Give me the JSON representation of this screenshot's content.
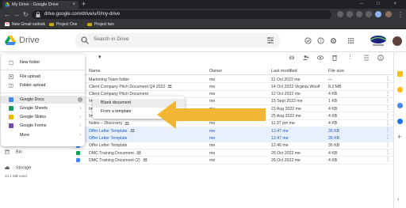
{
  "browser": {
    "tab_title": "My Drive - Google Drive",
    "tab_close": "×",
    "new_tab": "+",
    "window_controls": "–  □  ×",
    "url": "drive.google.com/drive/u/0/my-drive",
    "bookmarks": [
      "New Gmail outlook",
      "Project One",
      "Project two"
    ]
  },
  "drive": {
    "title": "Drive",
    "search_placeholder": "Search in Drive"
  },
  "toolbar": {
    "breadcrumb_chevron": "▾"
  },
  "table": {
    "headers": {
      "name": "Name",
      "owner": "Owner",
      "modified": "Last modified",
      "size": "File size"
    },
    "rows": [
      {
        "name": "Marketing Team folder",
        "owner": "me",
        "modified": "11 Oct 2022 me",
        "size": "—",
        "icon": "folder",
        "shared": false,
        "selected": false
      },
      {
        "name": "Client Company Pitch Document Q4 2022",
        "owner": "me",
        "modified": "14 Oct 2022 Virginia Woolf",
        "size": "8.2 MB",
        "icon": "pdf",
        "shared": true,
        "selected": false
      },
      {
        "name": "Client Company Pitch Document",
        "owner": "me",
        "modified": "12 Oct 2022 me",
        "size": "4 KB",
        "icon": "doc",
        "shared": false,
        "selected": false
      },
      {
        "name": "Important Sales Proposal",
        "owner": "me",
        "modified": "15 Sept 2022 me",
        "size": "1 KB",
        "icon": "doc",
        "shared": false,
        "selected": false
      },
      {
        "name": "Important Sales Proposal",
        "owner": "me",
        "modified": "23 Aug 2022 me",
        "size": "4 KB",
        "icon": "doc",
        "shared": true,
        "selected": false
      },
      {
        "name": "Important Sales Proposal",
        "owner": "me",
        "modified": "25 Aug 2022 me",
        "size": "4 KB",
        "icon": "doc",
        "shared": true,
        "selected": false
      },
      {
        "name": "Notes – Discovery",
        "owner": "me",
        "modified": "11:37 pm me",
        "size": "4 KB",
        "icon": "doc",
        "shared": true,
        "selected": false
      },
      {
        "name": "Offer Letter Template",
        "owner": "me",
        "modified": "12:47 me",
        "size": "35 KB",
        "icon": "doc",
        "shared": true,
        "selected": true
      },
      {
        "name": "Offer Letter Template",
        "owner": "me",
        "modified": "12:47 me",
        "size": "35 KB",
        "icon": "doc",
        "shared": false,
        "selected": true
      },
      {
        "name": "Offer Letter Template",
        "owner": "me",
        "modified": "12:46 me",
        "size": "35 KB",
        "icon": "doc",
        "shared": false,
        "selected": false
      },
      {
        "name": "DMC Training Document",
        "owner": "me",
        "modified": "26 Oct 2022 me",
        "size": "4 KB",
        "icon": "sheet",
        "shared": true,
        "selected": false
      },
      {
        "name": "DMC Training Document (2)",
        "owner": "me",
        "modified": "26 Oct 2022 me",
        "size": "4 KB",
        "icon": "doc",
        "shared": true,
        "selected": false
      }
    ]
  },
  "new_menu": {
    "items": [
      {
        "label": "New folder",
        "icon": "folder"
      },
      {
        "label": "File upload",
        "icon": "file-upload"
      },
      {
        "label": "Folder upload",
        "icon": "folder-upload"
      },
      {
        "label": "Google Docs",
        "icon": "docs",
        "chevron": "›",
        "highlighted": true
      },
      {
        "label": "Google Sheets",
        "icon": "sheets",
        "chevron": "›"
      },
      {
        "label": "Google Slides",
        "icon": "slides",
        "chevron": "›"
      },
      {
        "label": "Google Forms",
        "icon": "forms",
        "chevron": "›"
      },
      {
        "label": "More",
        "icon": "none",
        "chevron": "›"
      }
    ]
  },
  "submenu": {
    "items": [
      "Blank document",
      "From a template"
    ]
  },
  "sidebar": {
    "bin": "Bin",
    "storage": "Storage",
    "storage_used": "24.1 MB used"
  },
  "colors": {
    "docs": "#4285f4",
    "sheets": "#0f9d58",
    "slides": "#f4b400",
    "forms": "#7248b9",
    "pdf": "#ea4335",
    "folder": "#5f6368",
    "arrow": "#f2b12b",
    "selected": "#e8f0fe"
  }
}
